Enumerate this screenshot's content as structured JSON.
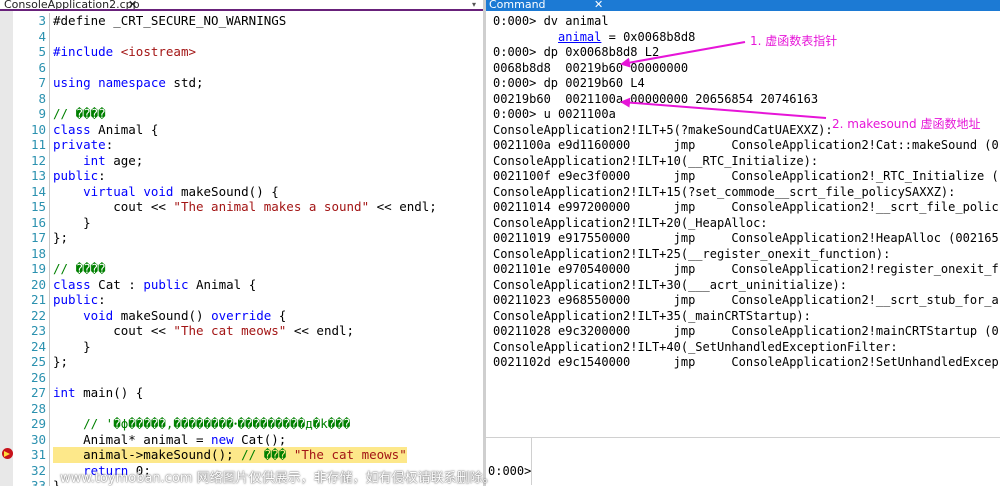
{
  "editor": {
    "tab_title": "ConsoleApplication2.cpp",
    "tab_close": "✕",
    "lines": [
      {
        "n": "3",
        "html": "#define _CRT_SECURE_NO_WARNINGS"
      },
      {
        "n": "4",
        "html": ""
      },
      {
        "n": "5",
        "html": "<span class='kw'>#include</span> <span class='inc'>&lt;iostream&gt;</span>"
      },
      {
        "n": "6",
        "html": ""
      },
      {
        "n": "7",
        "html": "<span class='kw'>using namespace</span> std;"
      },
      {
        "n": "8",
        "html": ""
      },
      {
        "n": "9",
        "html": "<span class='com'>// ����</span>"
      },
      {
        "n": "10",
        "html": "<span class='kw'>class</span> Animal {"
      },
      {
        "n": "11",
        "html": "<span class='kw'>private</span>:"
      },
      {
        "n": "12",
        "html": "    <span class='kw'>int</span> age;"
      },
      {
        "n": "13",
        "html": "<span class='kw'>public</span>:"
      },
      {
        "n": "14",
        "html": "    <span class='kw'>virtual void</span> makeSound() {"
      },
      {
        "n": "15",
        "html": "        cout &lt;&lt; <span class='str'>\"The animal makes a sound\"</span> &lt;&lt; endl;"
      },
      {
        "n": "16",
        "html": "    }"
      },
      {
        "n": "17",
        "html": "};"
      },
      {
        "n": "18",
        "html": ""
      },
      {
        "n": "19",
        "html": "<span class='com'>// ����</span>"
      },
      {
        "n": "20",
        "html": "<span class='kw'>class</span> Cat : <span class='kw'>public</span> Animal {"
      },
      {
        "n": "21",
        "html": "<span class='kw'>public</span>:"
      },
      {
        "n": "22",
        "html": "    <span class='kw'>void</span> makeSound() <span class='kw'>override</span> {"
      },
      {
        "n": "23",
        "html": "        cout &lt;&lt; <span class='str'>\"The cat meows\"</span> &lt;&lt; endl;"
      },
      {
        "n": "24",
        "html": "    }"
      },
      {
        "n": "25",
        "html": "};"
      },
      {
        "n": "26",
        "html": ""
      },
      {
        "n": "27",
        "html": "<span class='kw'>int</span> main() {"
      },
      {
        "n": "28",
        "html": ""
      },
      {
        "n": "29",
        "html": "    <span class='com'>// '�ϕ�����,��������ꞏ���������д�k���</span>"
      },
      {
        "n": "30",
        "html": "    Animal* animal = <span class='kw'>new</span> Cat();"
      },
      {
        "n": "31",
        "html": "    animal-&gt;makeSound(); <span class='com'>// ���</span> <span class='str'>\"The cat meows\"</span>",
        "hl": true
      },
      {
        "n": "32",
        "html": "    <span class='kw'>return</span> 0;"
      },
      {
        "n": "33",
        "html": "}"
      }
    ]
  },
  "command": {
    "tab_title": "Command",
    "tab_close": "✕",
    "lines": [
      {
        "t": "0:000> dv animal"
      },
      {
        "t": "         ",
        "link": "animal",
        "rest": " = 0x0068b8d8"
      },
      {
        "t": "0:000> dp 0x0068b8d8 L2"
      },
      {
        "t": "0068b8d8  00219b60 00000000"
      },
      {
        "t": "0:000> dp 00219b60 L4"
      },
      {
        "t": "00219b60  0021100a 00000000 20656854 20746163"
      },
      {
        "t": "0:000> u 0021100a"
      },
      {
        "t": "ConsoleApplication2!ILT+5(?makeSoundCatUAEXXZ):"
      },
      {
        "t": "0021100a e9d1160000      jmp     ConsoleApplication2!Cat::makeSound (0"
      },
      {
        "t": "ConsoleApplication2!ILT+10(__RTC_Initialize):"
      },
      {
        "t": "0021100f e9ec3f0000      jmp     ConsoleApplication2!_RTC_Initialize ("
      },
      {
        "t": "ConsoleApplication2!ILT+15(?set_commode__scrt_file_policySAXXZ):"
      },
      {
        "t": "00211014 e997200000      jmp     ConsoleApplication2!__scrt_file_polic"
      },
      {
        "t": "ConsoleApplication2!ILT+20(_HeapAlloc:"
      },
      {
        "t": "00211019 e917550000      jmp     ConsoleApplication2!HeapAlloc (002165"
      },
      {
        "t": "ConsoleApplication2!ILT+25(__register_onexit_function):"
      },
      {
        "t": "0021101e e970540000      jmp     ConsoleApplication2!register_onexit_f"
      },
      {
        "t": "ConsoleApplication2!ILT+30(___acrt_uninitialize):"
      },
      {
        "t": "00211023 e968550000      jmp     ConsoleApplication2!__scrt_stub_for_a"
      },
      {
        "t": "ConsoleApplication2!ILT+35(_mainCRTStartup):"
      },
      {
        "t": "00211028 e9c3200000      jmp     ConsoleApplication2!mainCRTStartup (0"
      },
      {
        "t": "ConsoleApplication2!ILT+40(_SetUnhandledExceptionFilter:"
      },
      {
        "t": "0021102d e9c1540000      jmp     ConsoleApplication2!SetUnhandledExcep"
      }
    ],
    "prompt": "0:000>"
  },
  "annotations": {
    "note1": "1. 虚函数表指针",
    "note2": "2. makesound 虚函数地址",
    "arrow_color": "#e615d8"
  },
  "watermark": "www.toymoban.com 网络图片仅供展示，非存储，如有侵权请联系删除。",
  "colors": {
    "keyword": "#0000ff",
    "string": "#a31515",
    "comment": "#008000",
    "line_number": "#2b91af",
    "highlight": "#fde88a",
    "command_tab": "#1c7ad4"
  }
}
